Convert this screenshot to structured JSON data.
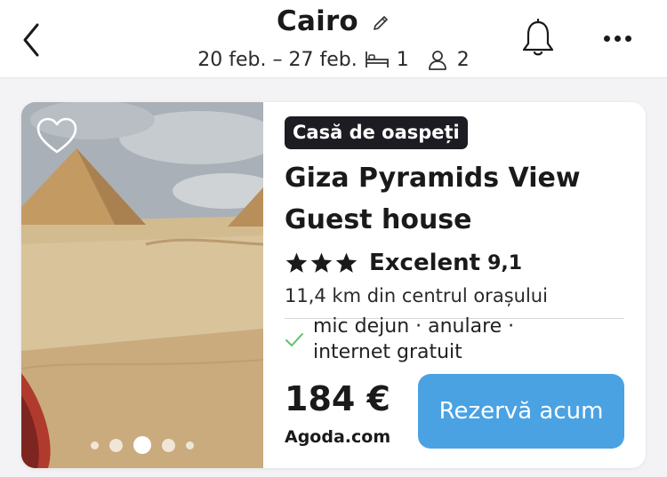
{
  "header": {
    "title": "Cairo",
    "dates": "20 feb. – 27 feb.",
    "rooms": "1",
    "guests": "2",
    "icons": [
      "back-arrow-icon",
      "pencil-icon",
      "bed-icon",
      "person-icon",
      "bell-icon",
      "more-icon"
    ]
  },
  "listing": {
    "badge": "Casă de oaspeți",
    "name": "Giza Pyramids View Guest house",
    "stars": 3,
    "rating_label": "Excelent",
    "rating_score": "9,1",
    "distance": "11,4 km din centrul orașului",
    "amenities": "mic dejun · anulare · internet gratuit",
    "price": "184 €",
    "provider": "Agoda.com",
    "book_label": "Rezervă acum",
    "photo_count": 5,
    "photo_active_index": 2,
    "favorite": false
  },
  "colors": {
    "accent": "#4aa2e3",
    "badge_bg": "#1c1c22",
    "check": "#5cc46b"
  }
}
